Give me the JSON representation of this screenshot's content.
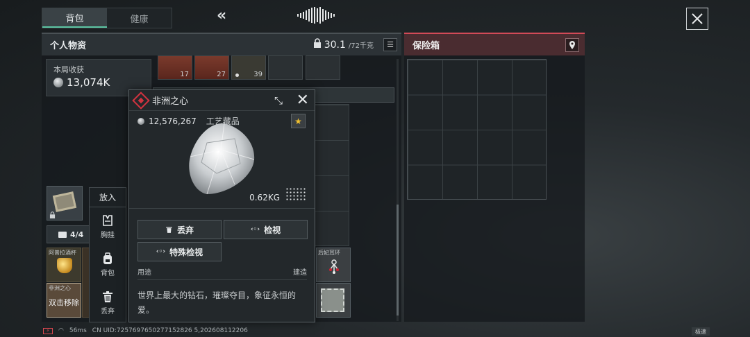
{
  "tabs": [
    {
      "label": "背包",
      "active": true
    },
    {
      "label": "健康",
      "active": false
    }
  ],
  "personal": {
    "title": "个人物资",
    "weight_current": "30.1",
    "weight_max": "/72千克",
    "harvest_label": "本局收获",
    "harvest_value": "13,074K",
    "top_slots": [
      {
        "count": "17"
      },
      {
        "count": "27"
      },
      {
        "count": "39"
      }
    ],
    "bag_count": "4/4",
    "items": {
      "cup_name": "阿普拉酒杯",
      "heart_name": "非洲之心",
      "double_remove": "双击移除",
      "earring_name": "后妃耳环"
    }
  },
  "put_menu": {
    "title": "放入",
    "items": [
      {
        "label": "胸挂",
        "icon": "vest-icon"
      },
      {
        "label": "背包",
        "icon": "backpack-icon"
      },
      {
        "label": "丢弃",
        "icon": "trash-icon"
      }
    ]
  },
  "safe": {
    "title": "保险箱"
  },
  "detail": {
    "name": "非洲之心",
    "price": "12,576,267",
    "category": "工艺藏品",
    "weight": "0.62KG",
    "btn_discard": "丢弃",
    "btn_inspect": "检视",
    "btn_special": "特殊检视",
    "usage_label": "用途",
    "usage_value": "建造",
    "description": "世界上最大的钻石，璀璨夺目，象征永恒的爱。"
  },
  "status": {
    "ping": "56ms",
    "uid": "CN UID:7257697650277152826 5,202608112206"
  },
  "speed_label": "极速",
  "colors": {
    "accent_tab": "#5dc6a4",
    "safe_accent": "#d24a57",
    "rarity_red": "#d2333f",
    "star": "#f2c230"
  }
}
